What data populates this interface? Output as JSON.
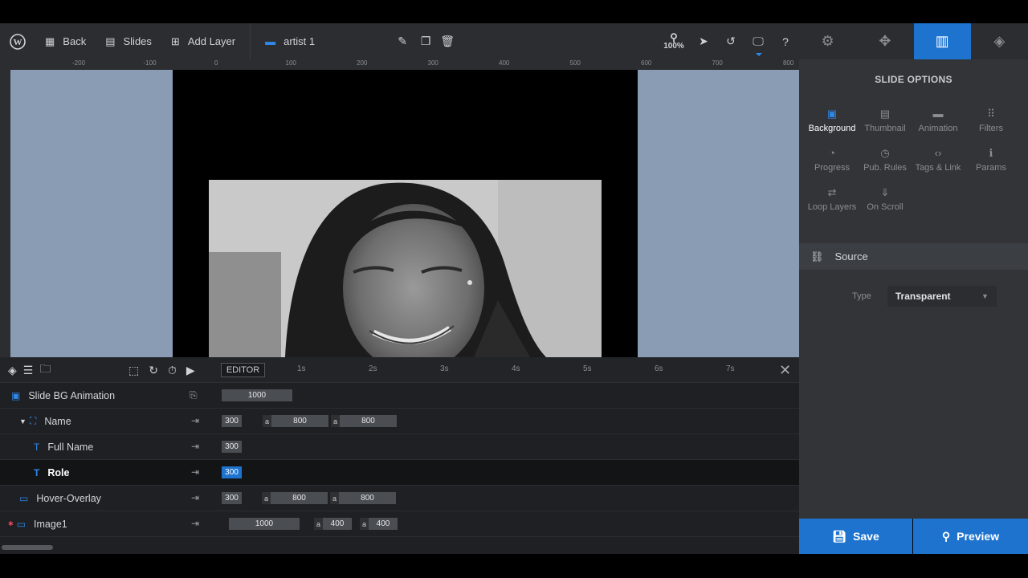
{
  "toolbar": {
    "back_label": "Back",
    "slides_label": "Slides",
    "add_layer_label": "Add Layer",
    "slide_name": "artist 1",
    "zoom": "100%"
  },
  "ruler": {
    "h_ticks": [
      "-200",
      "-100",
      "0",
      "100",
      "200",
      "300",
      "400",
      "500",
      "600",
      "700",
      "800"
    ]
  },
  "panel": {
    "title": "SLIDE OPTIONS",
    "options": [
      {
        "label": "Background",
        "icon": "image-icon",
        "glyph": "▣",
        "active": true
      },
      {
        "label": "Thumbnail",
        "icon": "thumbnail-icon",
        "glyph": "▤",
        "active": false
      },
      {
        "label": "Animation",
        "icon": "clapper-icon",
        "glyph": "▬",
        "active": false
      },
      {
        "label": "Filters",
        "icon": "filters-icon",
        "glyph": "⠿",
        "active": false
      },
      {
        "label": "Progress",
        "icon": "stopwatch-icon",
        "glyph": "◔",
        "active": false
      },
      {
        "label": "Pub. Rules",
        "icon": "clock-icon",
        "glyph": "◷",
        "active": false
      },
      {
        "label": "Tags & Link",
        "icon": "code-icon",
        "glyph": "‹›",
        "active": false
      },
      {
        "label": "Params",
        "icon": "info-icon",
        "glyph": "ℹ",
        "active": false
      },
      {
        "label": "Loop Layers",
        "icon": "loop-icon",
        "glyph": "⇄",
        "active": false
      },
      {
        "label": "On Scroll",
        "icon": "scroll-icon",
        "glyph": "⇓",
        "active": false
      }
    ],
    "source_label": "Source",
    "type_label": "Type",
    "type_value": "Transparent"
  },
  "buttons": {
    "save": "Save",
    "preview": "Preview"
  },
  "timeline": {
    "editor_label": "EDITOR",
    "seconds": [
      "1s",
      "2s",
      "3s",
      "4s",
      "5s",
      "6s",
      "7s"
    ],
    "rows": [
      {
        "label": "Slide BG Animation",
        "b1": "1000"
      },
      {
        "label": "Name",
        "b1": "300",
        "b2": "800",
        "b3": "800"
      },
      {
        "label": "Full Name",
        "b1": "300"
      },
      {
        "label": "Role",
        "b1": "300"
      },
      {
        "label": "Hover-Overlay",
        "b1": "300",
        "b2": "800",
        "b3": "800"
      },
      {
        "label": "Image1",
        "b1": "1000",
        "b2": "400",
        "b3": "400"
      }
    ],
    "a_marker": "a"
  },
  "colors": {
    "accent": "#1e73ce",
    "canvas_bg": "#8a9bb4",
    "panel_bg": "#323438"
  }
}
